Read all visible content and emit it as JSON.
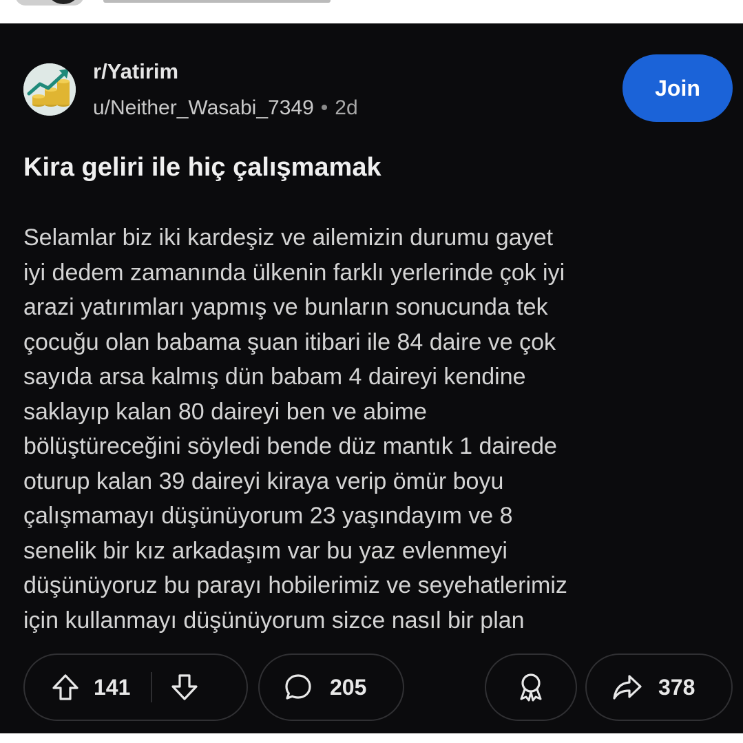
{
  "post": {
    "subreddit": "r/Yatirim",
    "author": "u/Neither_Wasabi_7349",
    "separator": "•",
    "age": "2d",
    "join_label": "Join",
    "title": "Kira geliri ile hiç çalışmamak",
    "body_lines": [
      "Selamlar biz iki kardeşiz ve ailemizin durumu gayet",
      "iyi dedem zamanında ülkenin farklı yerlerinde çok iyi",
      "arazi yatırımları yapmış ve bunların sonucunda tek",
      "çocuğu olan babama şuan itibari ile 84 daire ve çok",
      "sayıda arsa kalmış dün babam 4 daireyi kendine",
      "saklayıp kalan 80 daireyi ben ve abime",
      "bölüştüreceğini söyledi bende düz mantık 1 dairede",
      "oturup kalan 39 daireyi kiraya verip ömür boyu",
      "çalışmamayı düşünüyorum 23 yaşındayım ve 8",
      "senelik bir kız arkadaşım var bu yaz evlenmeyi",
      "düşünüyoruz bu parayı hobilerimiz ve seyehatlerimiz",
      "için kullanmayı düşünüyorum sizce nasıl bir plan"
    ]
  },
  "actions": {
    "upvotes": "141",
    "comments": "205",
    "shares": "378"
  },
  "icons": {
    "avatar": "subreddit-avatar-chart-coins",
    "upvote": "arrow-up-icon",
    "downvote": "arrow-down-icon",
    "comment": "speech-bubble-icon",
    "award": "award-ribbon-icon",
    "share": "share-arrow-icon"
  },
  "colors": {
    "background": "#0b0b0d",
    "join_button": "#1b63d8",
    "text_primary": "#f0f0f0",
    "text_body": "#d4d4d4"
  }
}
